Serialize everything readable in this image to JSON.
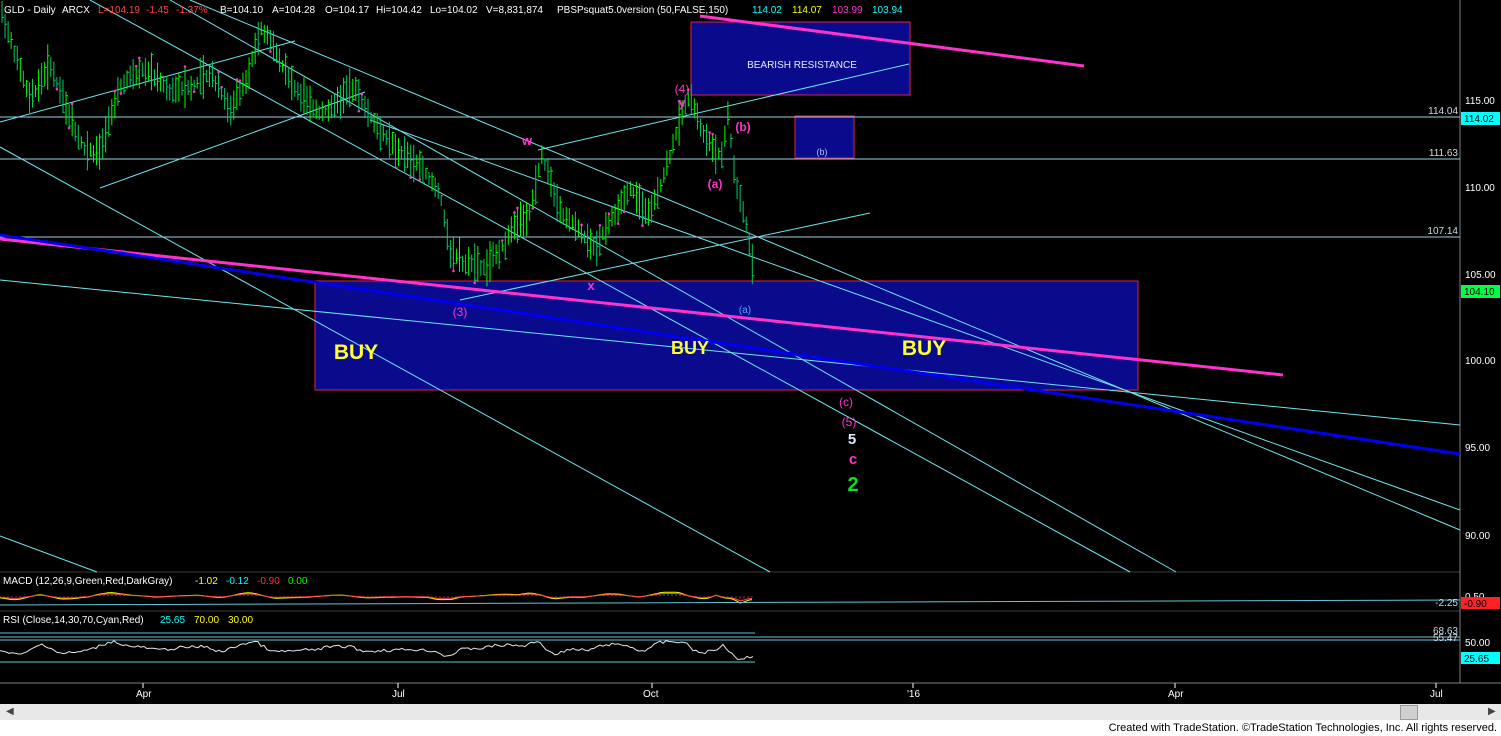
{
  "header": {
    "symbol": "GLD - Daily",
    "exchange": "ARCX",
    "last": "L=104.19",
    "change": "-1.45",
    "change_pct": "-1.37%",
    "bid": "B=104.10",
    "ask": "A=104.28",
    "open": "O=104.17",
    "high": "Hi=104.42",
    "low": "Lo=104.02",
    "volume": "V=8,831,874",
    "indicator": "PBSPsquat5.0version (50,FALSE,150)",
    "ind_values": [
      "114.02",
      "114.07",
      "103.99",
      "103.94"
    ]
  },
  "colors": {
    "background": "#000000",
    "bar": "#00ff00",
    "channel": "#6ee6ee",
    "magenta": "#ff33cc",
    "blue_line": "#0000ee",
    "zone_fill": "#0a0a8c",
    "zone_border": "#e0204a",
    "buy_text": "#ffff33",
    "axis_bg": "#000000",
    "price_tag_bg": "#00ffff"
  },
  "price_axis": {
    "ticks": [
      "115.00",
      "110.00",
      "105.00",
      "100.00",
      "95.00",
      "90.00"
    ],
    "current_tag": "104.10",
    "level_tag": "114.02"
  },
  "levels": [
    {
      "label": "114.04",
      "price": 114.04
    },
    {
      "label": "111.63",
      "price": 111.63
    },
    {
      "label": "107.14",
      "price": 107.14
    }
  ],
  "zones": {
    "bearish_resistance": "BEARISH RESISTANCE",
    "b_box_label": "(b)",
    "buy_labels": [
      "BUY",
      "BUY",
      "BUY"
    ]
  },
  "wave_labels": {
    "w": "w",
    "x": "x",
    "y": "y",
    "four": "(4)",
    "three": "(3)",
    "b": "(b)",
    "a": "(a)",
    "a_small": "(a)",
    "c_paren": "(c)",
    "five_paren": "(5)",
    "five": "5",
    "c": "c",
    "two": "2"
  },
  "x_axis": {
    "ticks": [
      "Apr",
      "Jul",
      "Oct",
      "'16",
      "Apr",
      "Jul"
    ]
  },
  "macd": {
    "title": "MACD (12,26,9,Green,Red,DarkGray)",
    "values": [
      "-1.02",
      "-0.12",
      "-0.90",
      "0.00"
    ],
    "axis_labels": [
      "0.50",
      "-2.25"
    ],
    "tag": "-0.90"
  },
  "rsi": {
    "title": "RSI (Close,14,30,70,Cyan,Red)",
    "values": [
      "25.65",
      "70.00",
      "30.00"
    ],
    "axis_labels": [
      "68.63",
      "55.47",
      "50.00"
    ],
    "tag": "25.65"
  },
  "footer": "Created with TradeStation. ©TradeStation Technologies, Inc. All rights reserved.",
  "chart_data": {
    "type": "ohlc",
    "title": "GLD - Daily",
    "ylim": [
      88.2,
      118.9
    ],
    "x_months": [
      "Apr",
      "Jul",
      "Oct",
      "'16",
      "Apr",
      "Jul"
    ],
    "anchors": [
      {
        "x": 0,
        "y": 118.5
      },
      {
        "x": 12,
        "y": 116.5
      },
      {
        "x": 30,
        "y": 113.5
      },
      {
        "x": 50,
        "y": 115.5
      },
      {
        "x": 70,
        "y": 112.5
      },
      {
        "x": 85,
        "y": 110.8
      },
      {
        "x": 100,
        "y": 110.7
      },
      {
        "x": 120,
        "y": 114.3
      },
      {
        "x": 145,
        "y": 115.2
      },
      {
        "x": 170,
        "y": 114.0
      },
      {
        "x": 190,
        "y": 114.2
      },
      {
        "x": 210,
        "y": 115.0
      },
      {
        "x": 230,
        "y": 113.0
      },
      {
        "x": 245,
        "y": 114.5
      },
      {
        "x": 262,
        "y": 117.5
      },
      {
        "x": 280,
        "y": 115.5
      },
      {
        "x": 300,
        "y": 113.8
      },
      {
        "x": 320,
        "y": 112.8
      },
      {
        "x": 340,
        "y": 113.5
      },
      {
        "x": 355,
        "y": 114.2
      },
      {
        "x": 372,
        "y": 112.5
      },
      {
        "x": 395,
        "y": 111.0
      },
      {
        "x": 420,
        "y": 110.0
      },
      {
        "x": 440,
        "y": 108.5
      },
      {
        "x": 450,
        "y": 105.5
      },
      {
        "x": 462,
        "y": 104.8
      },
      {
        "x": 485,
        "y": 104.5
      },
      {
        "x": 500,
        "y": 105.5
      },
      {
        "x": 518,
        "y": 107.0
      },
      {
        "x": 530,
        "y": 107.5
      },
      {
        "x": 542,
        "y": 110.5
      },
      {
        "x": 560,
        "y": 107.5
      },
      {
        "x": 580,
        "y": 106.5
      },
      {
        "x": 595,
        "y": 105.5
      },
      {
        "x": 612,
        "y": 107.2
      },
      {
        "x": 630,
        "y": 108.8
      },
      {
        "x": 650,
        "y": 107.3
      },
      {
        "x": 668,
        "y": 110.2
      },
      {
        "x": 680,
        "y": 112.5
      },
      {
        "x": 690,
        "y": 114.0
      },
      {
        "x": 700,
        "y": 112.2
      },
      {
        "x": 712,
        "y": 111.0
      },
      {
        "x": 722,
        "y": 110.5
      },
      {
        "x": 728,
        "y": 112.8
      },
      {
        "x": 736,
        "y": 109.0
      },
      {
        "x": 745,
        "y": 107.2
      },
      {
        "x": 754,
        "y": 104.2
      }
    ],
    "levels": [
      114.04,
      111.63,
      107.14
    ],
    "rsi_last": 25.65,
    "macd_last": -0.9
  }
}
